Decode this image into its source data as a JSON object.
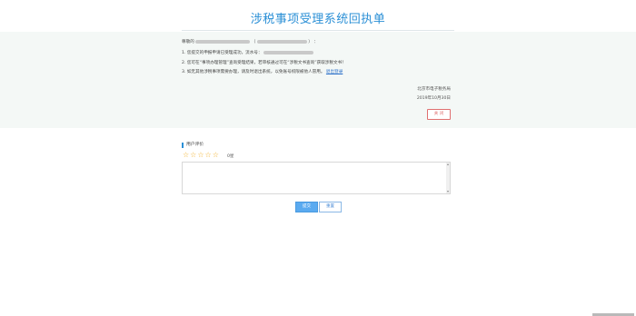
{
  "header": {
    "title": "涉税事项受理系统回执单"
  },
  "receipt": {
    "greeting_prefix": "尊敬的",
    "greeting_suffix": "：",
    "line1_text": "1. 您提交的申报申请已受理成功，流水号：",
    "line2_prefix": "2. 您可在",
    "line2_q1": "“事项办理管理”",
    "line2_mid": "查询受理结果，若审核通过可在",
    "line2_q2": "“涉税文书查询”",
    "line2_suffix": "获取涉税文书！",
    "line3_text": "3. 如无其他涉税事项需要办理，请及时退出系统，以免账号权限被他人冒用。",
    "logout_link": "退出登录",
    "org": "北京市电子税务局",
    "date": "2019年10月30日",
    "close_label": "关 闭"
  },
  "evaluation": {
    "section_title": "用户评价",
    "stars": "☆☆☆☆☆",
    "score": "0星",
    "submit_label": "提交",
    "reset_label": "重置"
  },
  "colors": {
    "accent": "#2a8fd6",
    "close": "#e07070",
    "star": "#f2b330",
    "submit": "#5aaaf0"
  }
}
